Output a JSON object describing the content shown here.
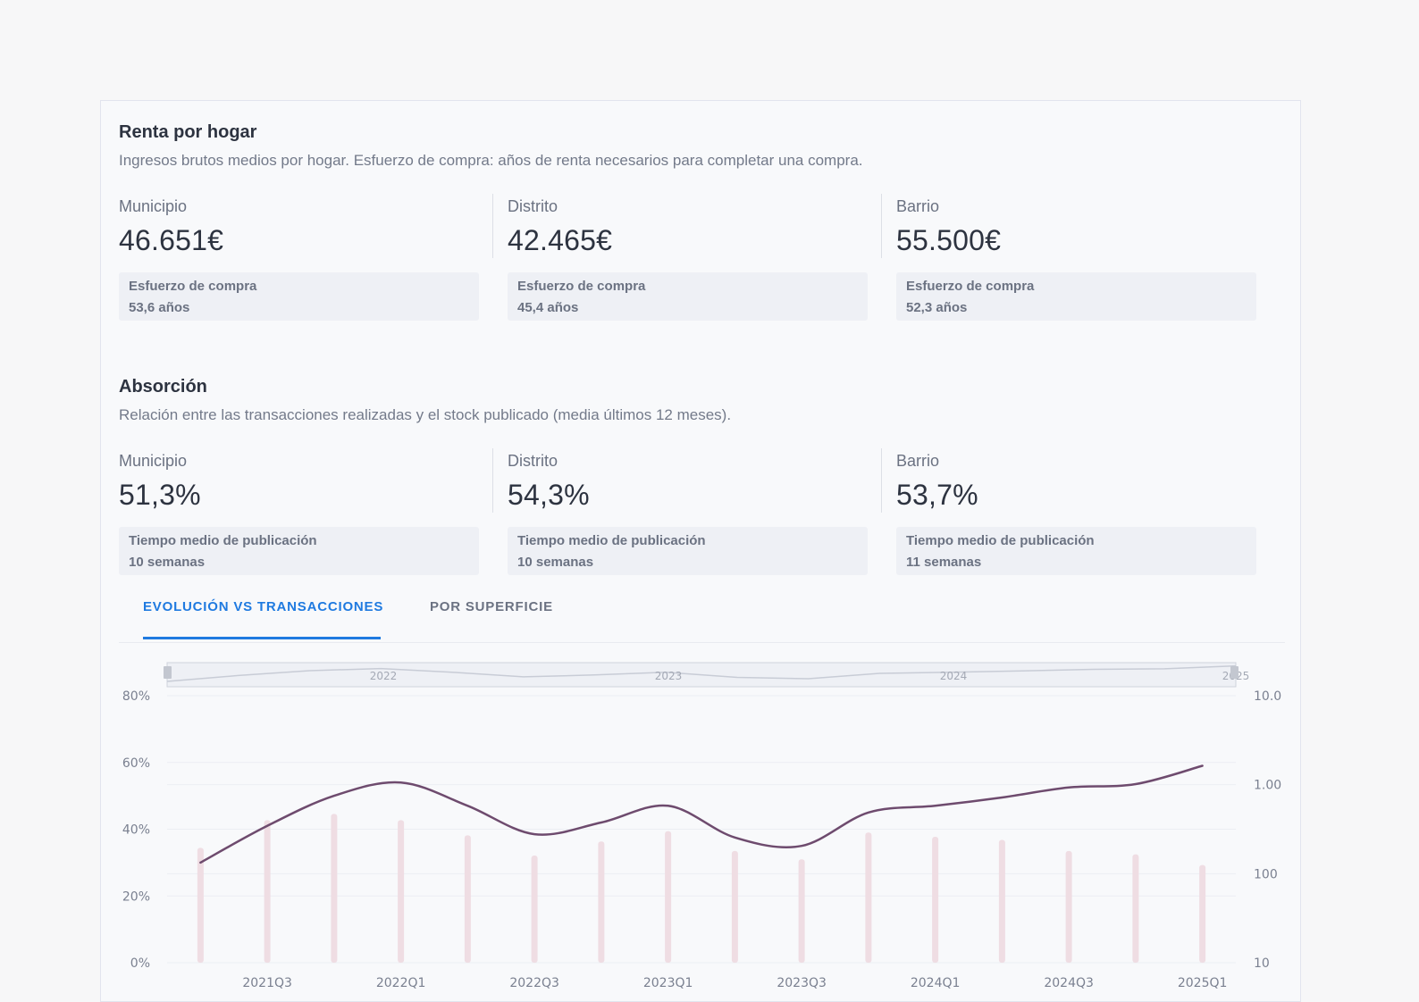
{
  "renta": {
    "title": "Renta por hogar",
    "description": "Ingresos brutos medios por hogar. Esfuerzo de compra: años de renta necesarios para completar una compra.",
    "columns": [
      {
        "label": "Municipio",
        "value": "46.651€",
        "box_label": "Esfuerzo de compra",
        "box_value": "53,6 años"
      },
      {
        "label": "Distrito",
        "value": "42.465€",
        "box_label": "Esfuerzo de compra",
        "box_value": "45,4 años"
      },
      {
        "label": "Barrio",
        "value": "55.500€",
        "box_label": "Esfuerzo de compra",
        "box_value": "52,3 años"
      }
    ]
  },
  "absorcion": {
    "title": "Absorción",
    "description": "Relación entre las transacciones realizadas y el stock publicado (media últimos 12 meses).",
    "columns": [
      {
        "label": "Municipio",
        "value": "51,3%",
        "box_label": "Tiempo medio de publicación",
        "box_value": "10 semanas"
      },
      {
        "label": "Distrito",
        "value": "54,3%",
        "box_label": "Tiempo medio de publicación",
        "box_value": "10 semanas"
      },
      {
        "label": "Barrio",
        "value": "53,7%",
        "box_label": "Tiempo medio de publicación",
        "box_value": "11 semanas"
      }
    ]
  },
  "tabs": [
    {
      "label": "EVOLUCIÓN VS TRANSACCIONES",
      "active": true
    },
    {
      "label": "POR SUPERFICIE",
      "active": false
    }
  ],
  "colors": {
    "accent": "#1f7ae0",
    "line": "#6e4b6e",
    "bars": "#efdde3"
  },
  "chart_data": {
    "type": "line",
    "categories": [
      "2021Q2",
      "2021Q3",
      "2021Q4",
      "2022Q1",
      "2022Q2",
      "2022Q3",
      "2022Q4",
      "2023Q1",
      "2023Q2",
      "2023Q3",
      "2023Q4",
      "2024Q1",
      "2024Q2",
      "2024Q3",
      "2024Q4",
      "2025Q1"
    ],
    "x_tick_labels": [
      "2021Q3",
      "2022Q1",
      "2022Q3",
      "2023Q1",
      "2023Q3",
      "2024Q1",
      "2024Q3",
      "2025Q1"
    ],
    "series": [
      {
        "chart": "line",
        "axis": "left",
        "values": [
          30,
          41,
          50,
          54,
          47,
          38.5,
          42,
          47,
          37.5,
          35,
          45,
          47,
          49.5,
          52.5,
          53.5,
          59
        ]
      },
      {
        "chart": "bar",
        "axis": "right",
        "scale": "log",
        "values": [
          195,
          400,
          470,
          400,
          270,
          160,
          230,
          300,
          180,
          145,
          290,
          260,
          240,
          180,
          165,
          125
        ]
      }
    ],
    "y_left": {
      "ticks": [
        "0%",
        "20%",
        "40%",
        "60%",
        "80%"
      ],
      "range": [
        0,
        80
      ]
    },
    "y_right": {
      "ticks": [
        "10",
        "100",
        "1.00",
        "10.0"
      ],
      "scale": "log",
      "range": [
        10,
        10000
      ]
    },
    "navigator": {
      "labels": [
        "2022",
        "2023",
        "2024",
        "2025"
      ]
    },
    "grid": true
  }
}
